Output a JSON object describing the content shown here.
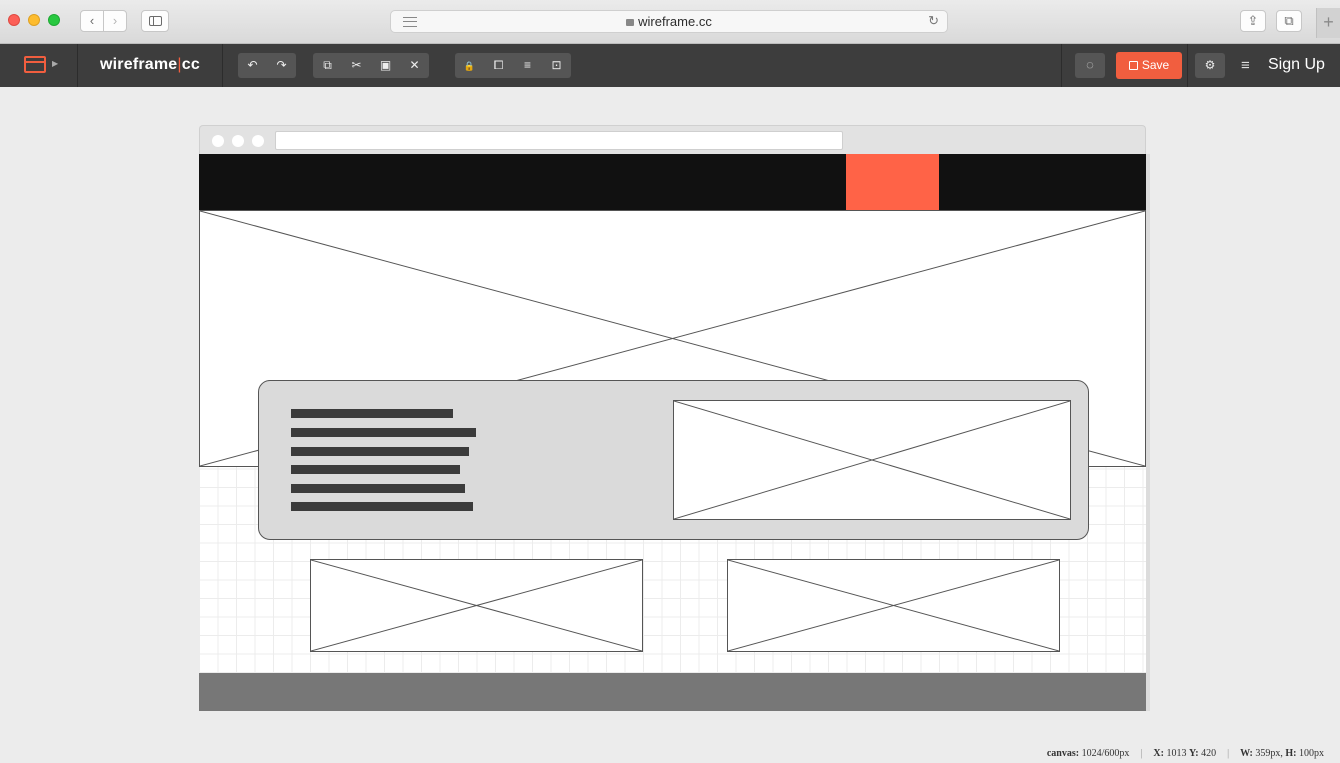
{
  "browser": {
    "url": "wireframe.cc",
    "nav_back": "‹",
    "nav_forward": "›",
    "reload_icon": "↻",
    "share_icon": "⇪",
    "tabs_icon": "⧉",
    "new_tab_icon": "+"
  },
  "app": {
    "brand_main": "wireframe",
    "brand_bar": "|",
    "brand_suffix": "cc",
    "accent_color": "#f15e3f",
    "toolbar_groups": [
      [
        "undo-icon",
        "redo-icon"
      ],
      [
        "copy-icon",
        "cut-icon",
        "paste-icon",
        "delete-icon"
      ],
      [
        "lock-icon",
        "bring-front-icon",
        "align-icon",
        "group-icon"
      ]
    ],
    "toolbar_glyphs": {
      "undo": "↶",
      "redo": "↷",
      "copy": "⧉",
      "cut": "✂",
      "paste": "▣",
      "delete": "✕",
      "lock": "🔒",
      "bring_front": "⧠",
      "align": "≡",
      "group": "⊡"
    },
    "speech_icon": "◌",
    "save_label": "Save",
    "settings_icon": "⚙",
    "menu_icon": "≡",
    "signup_label": "Sign Up"
  },
  "status": {
    "canvas_label": "canvas:",
    "canvas_value": "1024/600px",
    "x_label": "X:",
    "x_value": "1013",
    "y_label": "Y:",
    "y_value": "420",
    "w_label": "W:",
    "w_value": "359px,",
    "h_label": "H:",
    "h_value": "100px"
  }
}
